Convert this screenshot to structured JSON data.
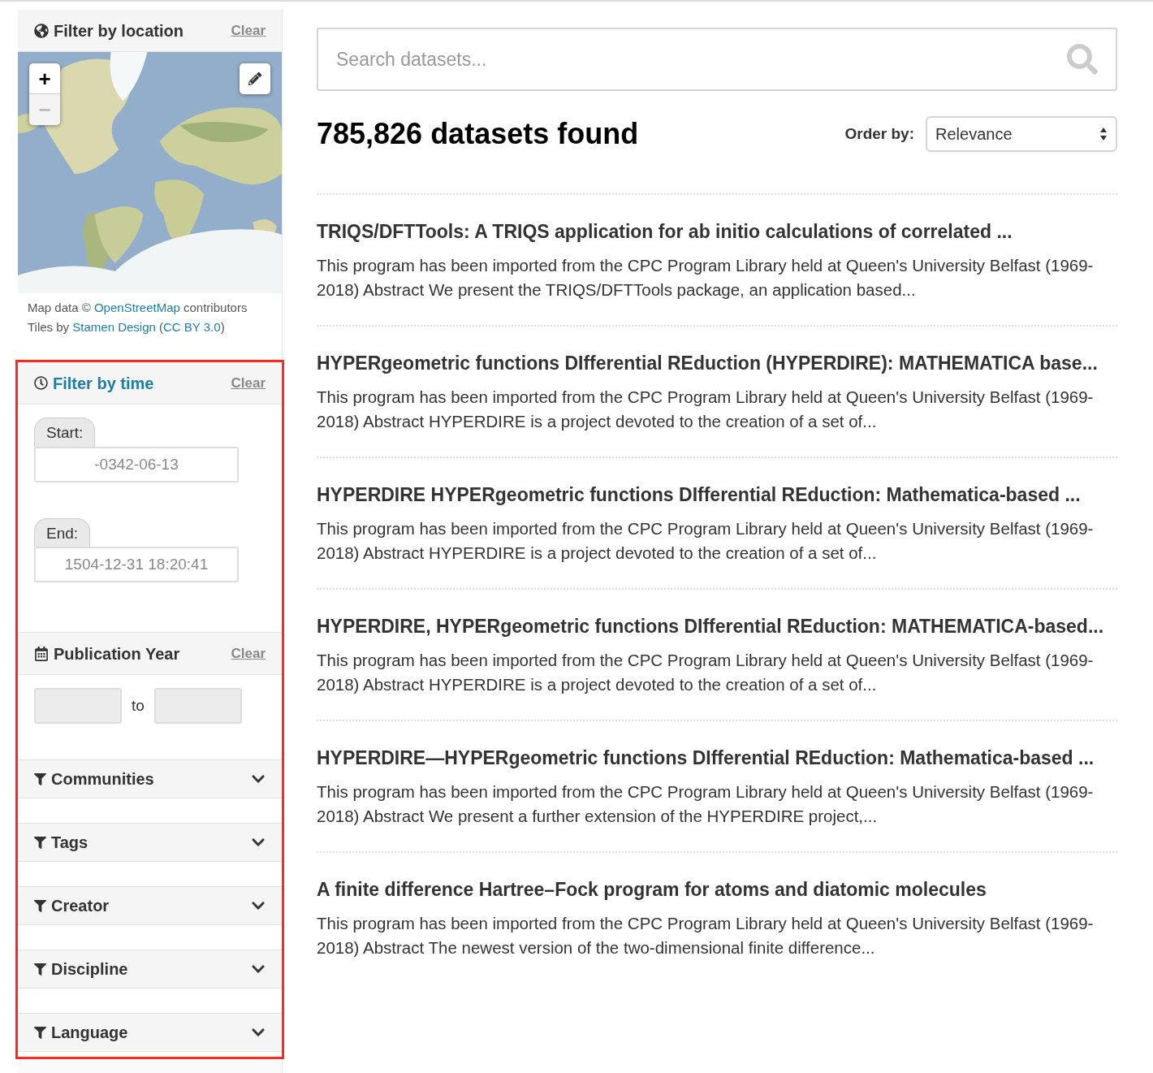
{
  "location_filter": {
    "title": "Filter by location",
    "clear": "Clear",
    "map": {
      "kind": "picture",
      "zoom_in": "+",
      "zoom_out": "−",
      "zoom_out_disabled": true
    },
    "attribution": [
      [
        {
          "text": "Map data © ",
          "link": false
        },
        {
          "text": "OpenStreetMap",
          "link": true
        },
        {
          "text": " contributors",
          "link": false
        }
      ],
      [
        {
          "text": "Tiles by ",
          "link": false
        },
        {
          "text": "Stamen Design",
          "link": true
        },
        {
          "text": " (",
          "link": false
        },
        {
          "text": "CC BY 3.0",
          "link": true
        },
        {
          "text": ")",
          "link": false
        }
      ]
    ]
  },
  "time_filter": {
    "title": "Filter by time",
    "active": true,
    "clear": "Clear",
    "start": {
      "label": "Start:",
      "placeholder": "-0342-06-13"
    },
    "end": {
      "label": "End:",
      "placeholder": "1504-12-31 18:20:41"
    }
  },
  "year_filter": {
    "title": "Publication Year",
    "active": false,
    "clear": "Clear",
    "separator": "to"
  },
  "facets": [
    {
      "label": "Communities",
      "expanded": false
    },
    {
      "label": "Tags",
      "expanded": false
    },
    {
      "label": "Creator",
      "expanded": false
    },
    {
      "label": "Discipline",
      "expanded": false
    },
    {
      "label": "Language",
      "expanded": false
    }
  ],
  "search": {
    "placeholder": "Search datasets..."
  },
  "results_count": "785,826 datasets found",
  "order": {
    "label": "Order by:",
    "value": "Relevance"
  },
  "results": [
    {
      "title": "TRIQS/DFTTools: A TRIQS application for ab initio calculations of correlated ...",
      "description": "This program has been imported from the CPC Program Library held at Queen's University Belfast (1969-2018) Abstract We present the TRIQS/DFTTools package, an application based..."
    },
    {
      "title": "HYPERgeometric functions DIfferential REduction (HYPERDIRE): MATHEMATICA base...",
      "description": "This program has been imported from the CPC Program Library held at Queen's University Belfast (1969-2018) Abstract HYPERDIRE is a project devoted to the creation of a set of..."
    },
    {
      "title": "HYPERDIRE HYPERgeometric functions DIfferential REduction: Mathematica-based ...",
      "description": "This program has been imported from the CPC Program Library held at Queen's University Belfast (1969-2018) Abstract HYPERDIRE is a project devoted to the creation of a set of..."
    },
    {
      "title": "HYPERDIRE, HYPERgeometric functions DIfferential REduction: MATHEMATICA-based...",
      "description": "This program has been imported from the CPC Program Library held at Queen's University Belfast (1969-2018) Abstract HYPERDIRE is a project devoted to the creation of a set of..."
    },
    {
      "title": "HYPERDIRE—HYPERgeometric functions DIfferential REduction: Mathematica-based ...",
      "description": "This program has been imported from the CPC Program Library held at Queen's University Belfast (1969-2018) Abstract We present a further extension of the HYPERDIRE project,..."
    },
    {
      "title": "A finite difference Hartree–Fock program for atoms and diatomic molecules",
      "description": "This program has been imported from the CPC Program Library held at Queen's University Belfast (1969-2018) Abstract The newest version of the two-dimensional finite difference..."
    }
  ]
}
